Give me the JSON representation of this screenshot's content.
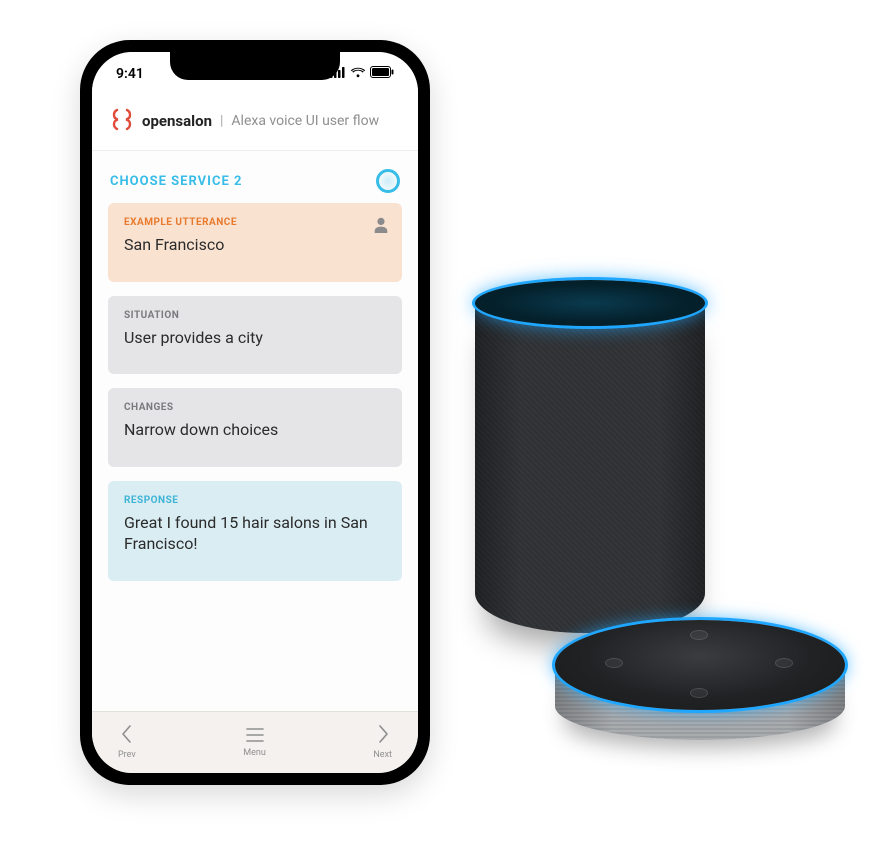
{
  "status": {
    "time": "9:41"
  },
  "header": {
    "brand": "opensalon",
    "separator": "|",
    "subtitle": "Alexa voice UI user flow"
  },
  "section": {
    "title": "CHOOSE SERVICE 2"
  },
  "cards": {
    "utterance": {
      "label": "EXAMPLE UTTERANCE",
      "body": "San Francisco"
    },
    "situation": {
      "label": "SITUATION",
      "body": "User provides a city"
    },
    "changes": {
      "label": "CHANGES",
      "body": "Narrow down choices"
    },
    "response": {
      "label": "RESPONSE",
      "body": "Great I found 15 hair salons in San Francisco!"
    }
  },
  "nav": {
    "prev": "Prev",
    "menu": "Menu",
    "next": "Next"
  }
}
